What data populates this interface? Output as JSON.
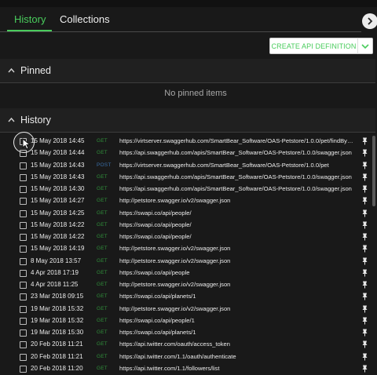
{
  "tabs": {
    "history": "History",
    "collections": "Collections"
  },
  "toolbar": {
    "create_label": "CREATE API DEFINITION",
    "dropdown_icon": "chevron-down-icon",
    "collapse_icon": "chevron-right-icon"
  },
  "pinned": {
    "title": "Pinned",
    "empty_message": "No pinned items"
  },
  "history": {
    "title": "History",
    "rows": [
      {
        "date": "15 May 2018 14:45",
        "method": "GET",
        "url": "https://virtserver.swaggerhub.com/SmartBear_Software/OAS-Petstore/1.0.0/pet/findByStatus?..."
      },
      {
        "date": "15 May 2018 14:44",
        "method": "GET",
        "url": "https://api.swaggerhub.com/apis/SmartBear_Software/OAS-Petstore/1.0.0/swagger.json"
      },
      {
        "date": "15 May 2018 14:43",
        "method": "POST",
        "url": "https://virtserver.swaggerhub.com/SmartBear_Software/OAS-Petstore/1.0.0/pet"
      },
      {
        "date": "15 May 2018 14:43",
        "method": "GET",
        "url": "https://api.swaggerhub.com/apis/SmartBear_Software/OAS-Petstore/1.0.0/swagger.json"
      },
      {
        "date": "15 May 2018 14:30",
        "method": "GET",
        "url": "https://api.swaggerhub.com/apis/SmartBear_Software/OAS-Petstore/1.0.0/swagger.json"
      },
      {
        "date": "15 May 2018 14:27",
        "method": "GET",
        "url": "http://petstore.swagger.io/v2/swagger.json"
      },
      {
        "date": "15 May 2018 14:25",
        "method": "GET",
        "url": "https://swapi.co/api/people/"
      },
      {
        "date": "15 May 2018 14:22",
        "method": "GET",
        "url": "https://swapi.co/api/people/"
      },
      {
        "date": "15 May 2018 14:22",
        "method": "GET",
        "url": "https://swapi.co/api/people/"
      },
      {
        "date": "15 May 2018 14:19",
        "method": "GET",
        "url": "http://petstore.swagger.io/v2/swagger.json"
      },
      {
        "date": "8 May 2018 13:57",
        "method": "GET",
        "url": "http://petstore.swagger.io/v2/swagger.json"
      },
      {
        "date": "4 Apr 2018 17:19",
        "method": "GET",
        "url": "https://swapi.co/api/people"
      },
      {
        "date": "4 Apr 2018 11:25",
        "method": "GET",
        "url": "http://petstore.swagger.io/v2/swagger.json"
      },
      {
        "date": "23 Mar 2018 09:15",
        "method": "GET",
        "url": "https://swapi.co/api/planets/1"
      },
      {
        "date": "19 Mar 2018 15:32",
        "method": "GET",
        "url": "http://petstore.swagger.io/v2/swagger.json"
      },
      {
        "date": "19 Mar 2018 15:32",
        "method": "GET",
        "url": "https://swapi.co/api/people/1"
      },
      {
        "date": "19 Mar 2018 15:30",
        "method": "GET",
        "url": "https://swapi.co/api/planets/1"
      },
      {
        "date": "20 Feb 2018 11:21",
        "method": "GET",
        "url": "https://api.twitter.com/oauth/access_token"
      },
      {
        "date": "20 Feb 2018 11:21",
        "method": "GET",
        "url": "https://api.twitter.com/1.1/oauth/authenticate"
      },
      {
        "date": "20 Feb 2018 11:20",
        "method": "GET",
        "url": "https://api.twitter.com/1.1/followers/list"
      }
    ]
  },
  "colors": {
    "accent": "#49cc5c",
    "get": "#2f8f3a",
    "post": "#3a6ea8",
    "background": "#191919"
  }
}
